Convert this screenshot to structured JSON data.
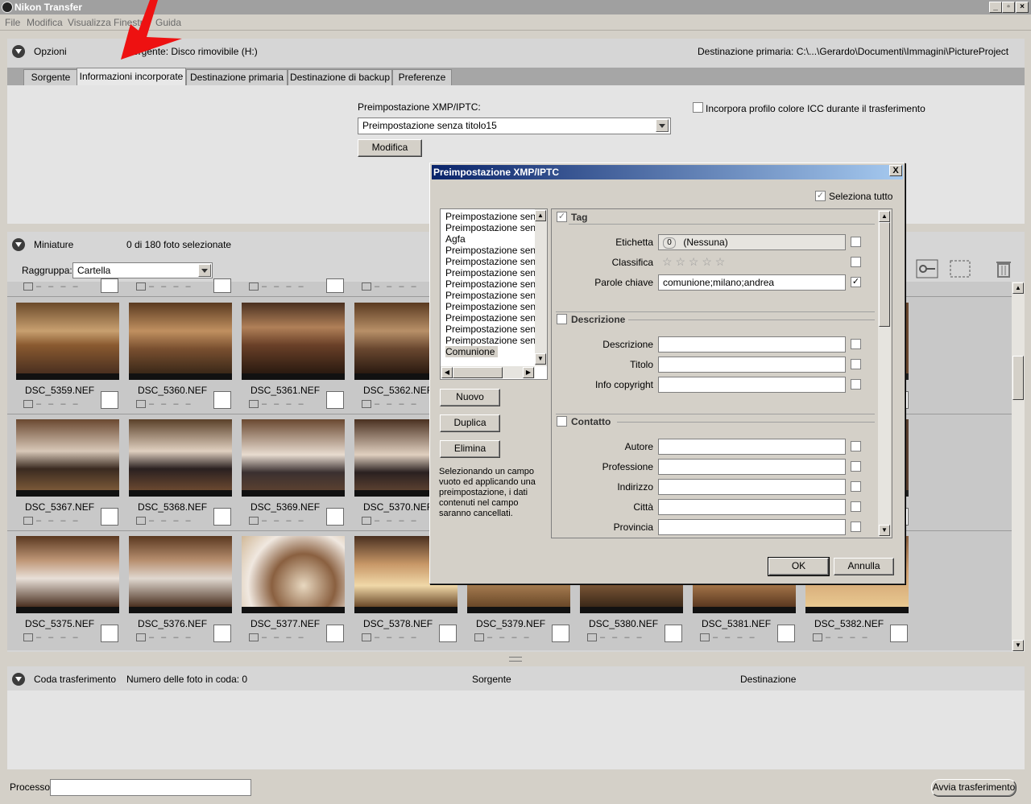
{
  "window": {
    "title": "Nikon Transfer"
  },
  "menu": [
    "File",
    "Modifica",
    "Visualizza",
    "Finestra",
    "Guida"
  ],
  "options": {
    "label": "Opzioni",
    "source": "Sorgente: Disco rimovibile (H:)",
    "destination": "Destinazione primaria: C:\\...\\Gerardo\\Documenti\\Immagini\\PictureProject",
    "tabs": [
      "Sorgente",
      "Informazioni incorporate",
      "Destinazione primaria",
      "Destinazione di backup",
      "Preferenze"
    ],
    "active_tab": "Informazioni incorporate",
    "preset_label": "Preimpostazione XMP/IPTC:",
    "preset_value": "Preimpostazione senza titolo15",
    "edit_button": "Modifica",
    "icc_label": "Incorpora profilo colore ICC durante il trasferimento"
  },
  "thumbnails_panel": {
    "label": "Miniature",
    "count": "0 di 180 foto selezionate",
    "group_label": "Raggruppa:",
    "group_value": "Cartella",
    "rows": [
      [
        "DSC_5359.NEF",
        "DSC_5360.NEF",
        "DSC_5361.NEF",
        "DSC_5362.NEF"
      ],
      [
        "DSC_5367.NEF",
        "DSC_5368.NEF",
        "DSC_5369.NEF",
        "DSC_5370.NEF"
      ],
      [
        "DSC_5375.NEF",
        "DSC_5376.NEF",
        "DSC_5377.NEF",
        "DSC_5378.NEF",
        "DSC_5379.NEF",
        "DSC_5380.NEF",
        "DSC_5381.NEF",
        "DSC_5382.NEF"
      ]
    ],
    "dash_text": "– – – –"
  },
  "queue": {
    "label": "Coda trasferimento",
    "count": "Numero delle foto in coda: 0",
    "col_source": "Sorgente",
    "col_dest": "Destinazione"
  },
  "footer": {
    "process_label": "Processo:",
    "start_button": "Avvia trasferimento"
  },
  "dialog": {
    "title": "Preimpostazione XMP/IPTC",
    "close": "X",
    "select_all": "Seleziona tutto",
    "presets": [
      "Preimpostazione senza",
      "Preimpostazione senza",
      "Agfa",
      "Preimpostazione senza",
      "Preimpostazione senza",
      "Preimpostazione senza",
      "Preimpostazione senza",
      "Preimpostazione senza",
      "Preimpostazione senza",
      "Preimpostazione senza",
      "Preimpostazione senza",
      "Preimpostazione senza",
      "Comunione"
    ],
    "btn_new": "Nuovo",
    "btn_duplicate": "Duplica",
    "btn_delete": "Elimina",
    "hint": [
      "Selezionando un campo",
      "vuoto ed applicando una",
      "preimpostazione, i dati",
      "contenuti nel campo",
      "saranno cancellati."
    ],
    "tag_section": "Tag",
    "label_field": "Etichetta",
    "label_value": "(Nessuna)",
    "label_num": "0",
    "rating_field": "Classifica",
    "rating_stars": "☆ ☆ ☆ ☆ ☆",
    "keywords_field": "Parole chiave",
    "keywords_value": "comunione;milano;andrea",
    "desc_section": "Descrizione",
    "desc_fields": [
      "Descrizione",
      "Titolo",
      "Info copyright"
    ],
    "contact_section": "Contatto",
    "contact_fields": [
      "Autore",
      "Professione",
      "Indirizzo",
      "Città",
      "Provincia"
    ],
    "ok": "OK",
    "cancel": "Annulla",
    "checkmark": "✓"
  }
}
